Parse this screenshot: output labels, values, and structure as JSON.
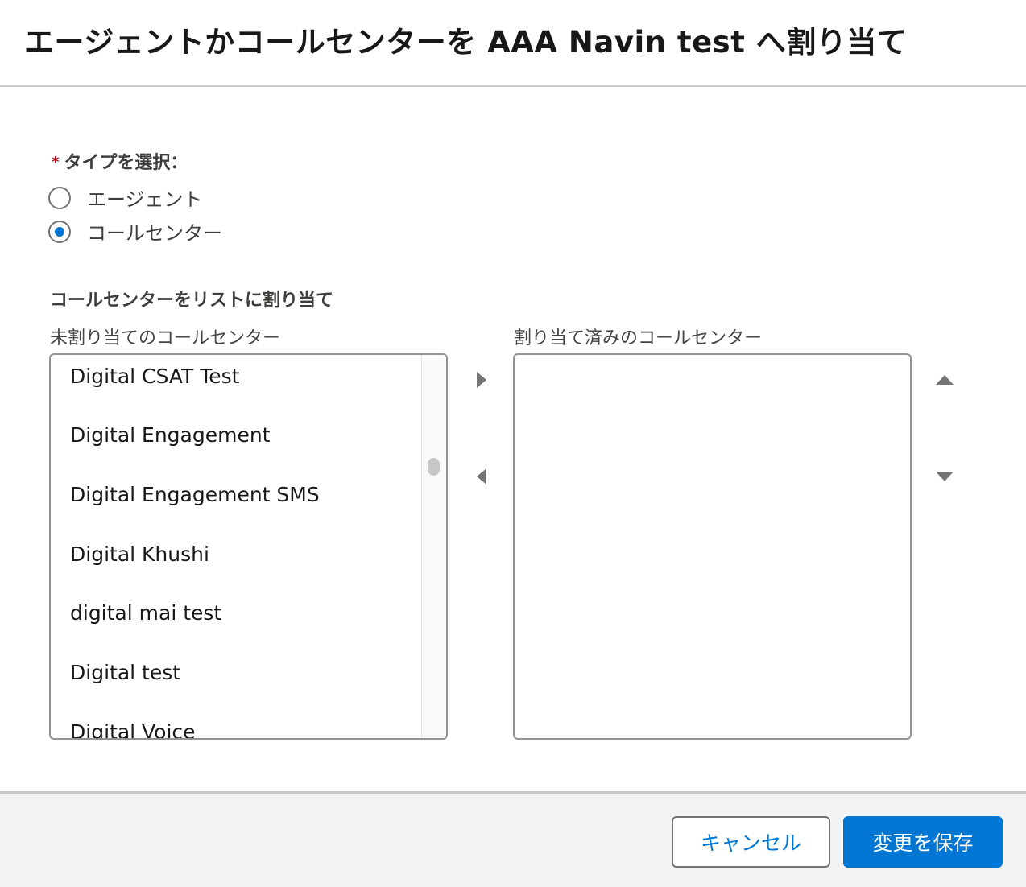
{
  "modal": {
    "title": "エージェントかコールセンターを AAA Navin test へ割り当て"
  },
  "type_select": {
    "required_mark": "*",
    "label": "タイプを選択：",
    "options": [
      {
        "label": "エージェント",
        "checked": false
      },
      {
        "label": "コールセンター",
        "checked": true
      }
    ]
  },
  "dual_list": {
    "title": "コールセンターをリストに割り当て",
    "available_label": "未割り当てのコールセンター",
    "selected_label": "割り当て済みのコールセンター",
    "available_items": [
      "Digital CSAT Test",
      "Digital Engagement",
      "Digital Engagement SMS",
      "Digital Khushi",
      "digital mai test",
      "Digital test",
      "Digital Voice"
    ],
    "selected_items": []
  },
  "footer": {
    "cancel_label": "キャンセル",
    "save_label": "変更を保存"
  },
  "colors": {
    "brand": "#0176d3",
    "required": "#ba0517"
  },
  "icons": {
    "move_right": "triangle-right-icon",
    "move_left": "triangle-left-icon",
    "move_up": "triangle-up-icon",
    "move_down": "triangle-down-icon"
  }
}
